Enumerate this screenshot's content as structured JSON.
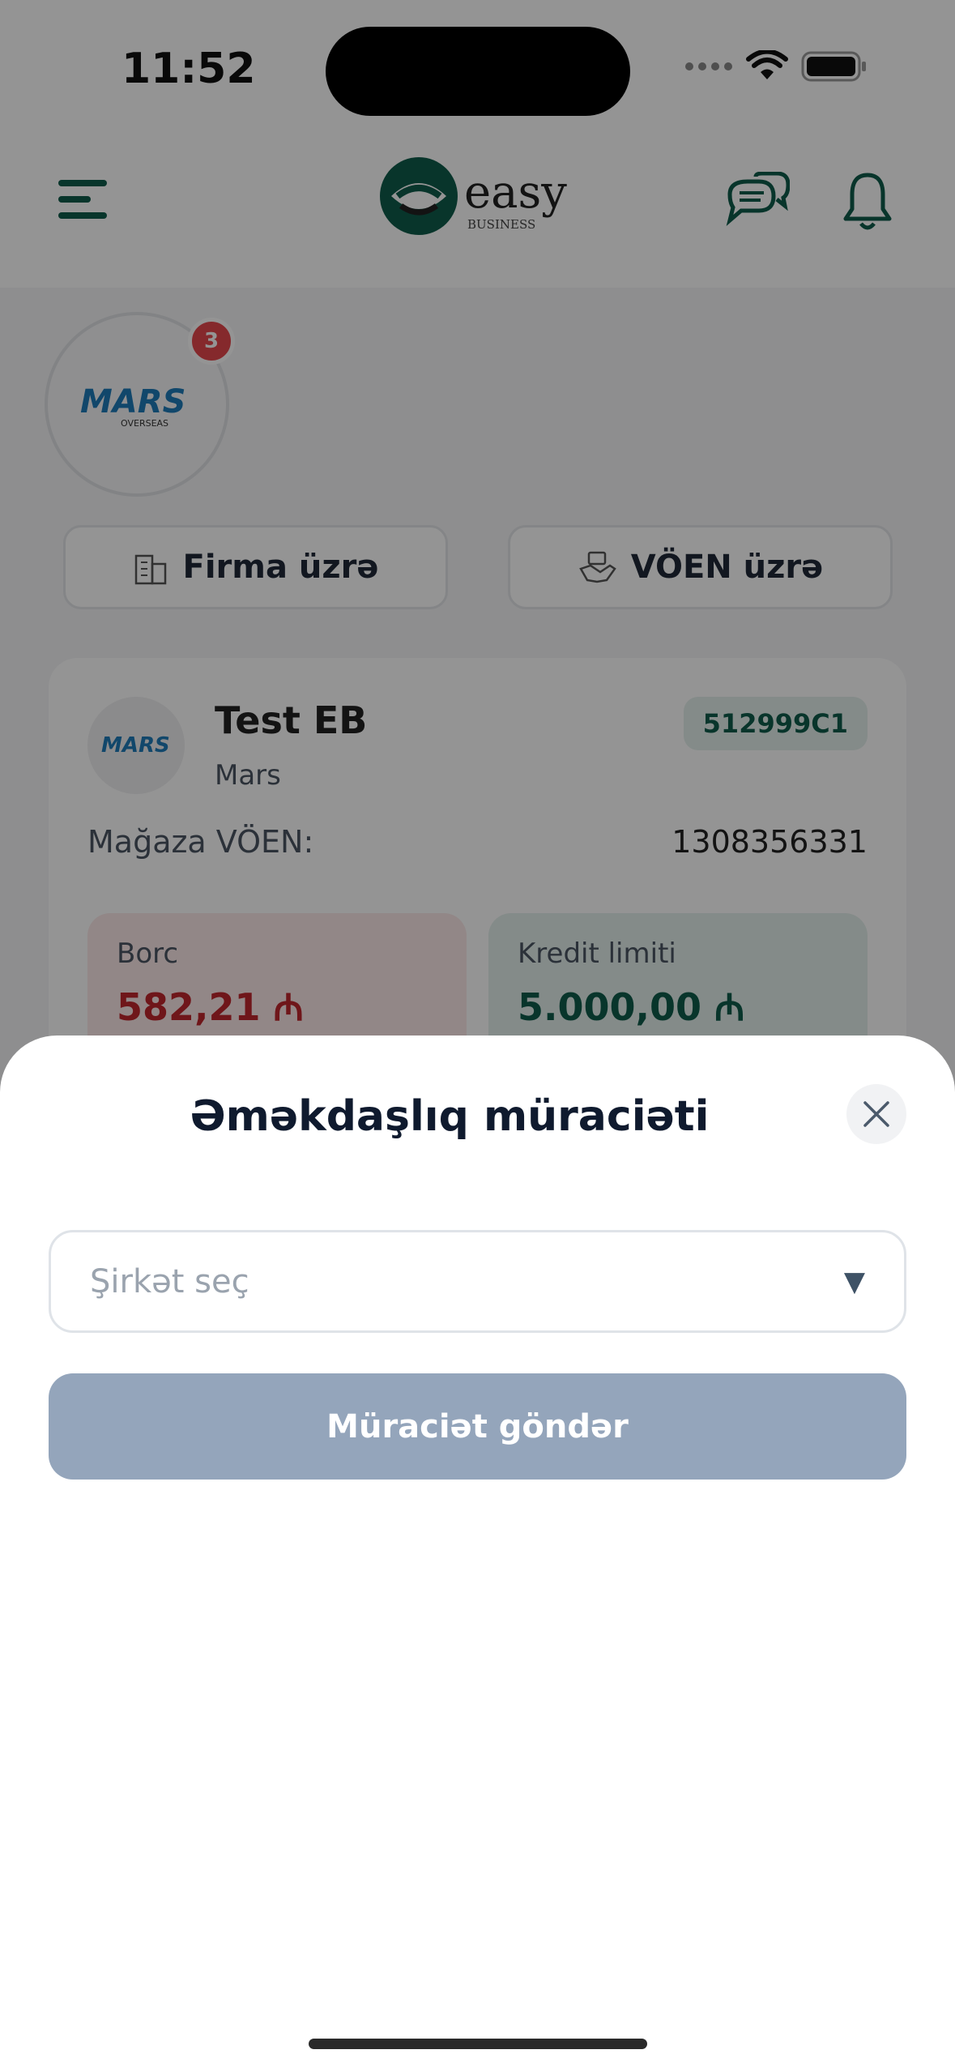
{
  "status_bar": {
    "time": "11:52"
  },
  "header": {
    "logo_text": "easy",
    "logo_sub": "BUSINESS"
  },
  "profile": {
    "avatar_brand": "MARS",
    "avatar_sub": "OVERSEAS",
    "badge_count": "3"
  },
  "filters": {
    "firma_label": "Firma üzrə",
    "voen_label": "VÖEN üzrə"
  },
  "card": {
    "title": "Test EB",
    "subtitle": "Mars",
    "code": "512999C1",
    "voen_label": "Mağaza VÖEN:",
    "voen_value": "1308356331",
    "borc_label": "Borc",
    "borc_value": "582,21 ₼",
    "kredit_label": "Kredit limiti",
    "kredit_value": "5.000,00 ₼"
  },
  "sheet": {
    "title": "Əməkdaşlıq müraciəti",
    "select_placeholder": "Şirkət seç",
    "select_arrow": "▼",
    "submit_label": "Müraciət göndər"
  },
  "colors": {
    "brand_teal": "#0f5c4a",
    "debt_red": "#c0262d",
    "submit_disabled": "#94a5bb"
  }
}
